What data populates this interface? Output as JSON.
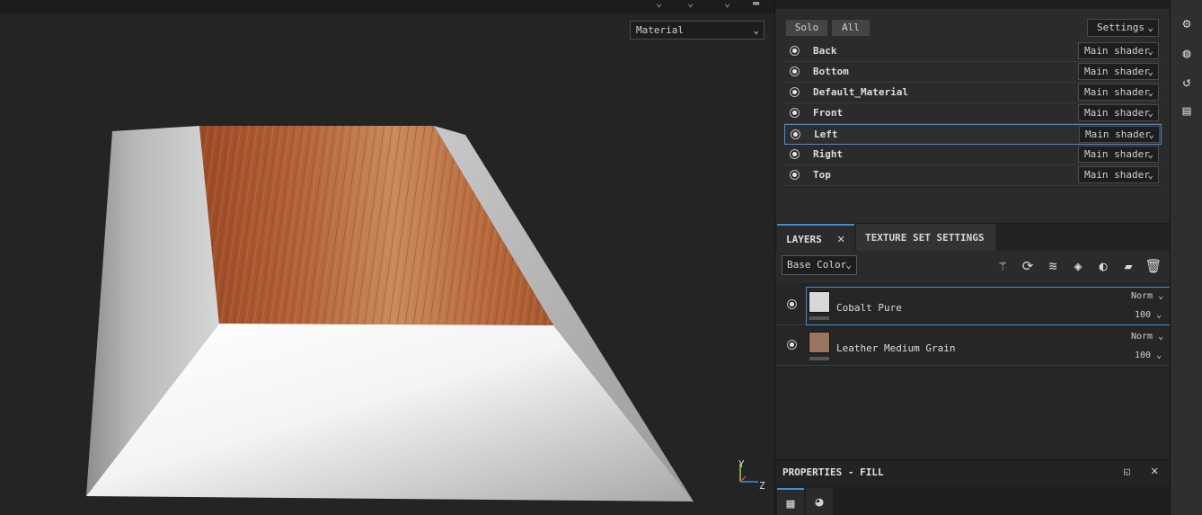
{
  "viewport": {
    "channel_select": "Material",
    "axis_y": "Y",
    "axis_z": "Z"
  },
  "texture_set_list": {
    "solo_label": "Solo",
    "all_label": "All",
    "settings_label": "Settings",
    "items": [
      {
        "name": "Back",
        "shader": "Main shader"
      },
      {
        "name": "Bottom",
        "shader": "Main shader"
      },
      {
        "name": "Default_Material",
        "shader": "Main shader"
      },
      {
        "name": "Front",
        "shader": "Main shader"
      },
      {
        "name": "Left",
        "shader": "Main shader",
        "selected": true
      },
      {
        "name": "Right",
        "shader": "Main shader"
      },
      {
        "name": "Top",
        "shader": "Main shader"
      }
    ]
  },
  "layers_panel": {
    "tabs": [
      {
        "label": "LAYERS",
        "active": true
      },
      {
        "label": "TEXTURE SET SETTINGS",
        "active": false
      }
    ],
    "channel": "Base Color",
    "tool_icons": [
      "magic-wand-icon",
      "smart-mask-icon",
      "add-layer-icon",
      "fill-layer-icon",
      "mask-icon",
      "add-folder-icon",
      "delete-icon"
    ],
    "layers": [
      {
        "name": "Cobalt Pure",
        "blend": "Norm",
        "opacity": "100",
        "thumb_color": "#d8d8d8",
        "selected": true
      },
      {
        "name": "Leather Medium Grain",
        "blend": "Norm",
        "opacity": "100",
        "thumb_color": "#9a7560",
        "selected": false
      }
    ]
  },
  "properties": {
    "title": "PROPERTIES - FILL"
  },
  "colors": {
    "accent": "#3c8fe0",
    "wood": "#a3552c",
    "panel": "#2b2b2b"
  }
}
